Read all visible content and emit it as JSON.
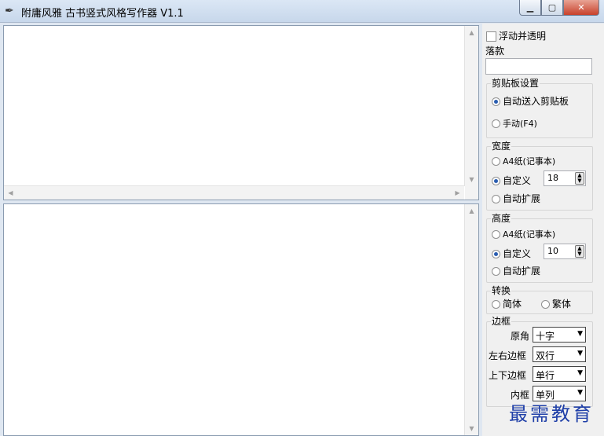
{
  "window": {
    "title": "附庸风雅 古书竖式风格写作器 V1.1",
    "app_icon": "pen-nib-icon",
    "min_glyph": "▁",
    "max_glyph": "▢",
    "close_glyph": "✕"
  },
  "editor": {
    "source_text": "",
    "output_text": ""
  },
  "options": {
    "float_transparent": "浮动并透明",
    "signature_label": "落款",
    "signature_value": "",
    "clipboard": {
      "title": "剪贴板设置",
      "auto": "自动送入剪贴板",
      "manual": "手动(F4)",
      "selected": "auto"
    },
    "width": {
      "title": "宽度",
      "a4": "A4纸(记事本)",
      "custom": "自定义",
      "custom_value": "18",
      "auto_expand": "自动扩展",
      "selected": "custom"
    },
    "height": {
      "title": "高度",
      "a4": "A4纸(记事本)",
      "custom": "自定义",
      "custom_value": "10",
      "auto_expand": "自动扩展",
      "selected": "custom"
    },
    "convert": {
      "title": "转换",
      "simplified": "简体",
      "traditional": "繁体"
    },
    "border": {
      "title": "边框",
      "corner_label": "原角",
      "corner_value": "十字",
      "lr_label": "左右边框",
      "lr_value": "双行",
      "tb_label": "上下边框",
      "tb_value": "单行",
      "inner_label": "内框",
      "inner_value": "单列"
    }
  },
  "watermark": "最需教育",
  "colors": {
    "radio_dot": "#2a5db0",
    "watermark": "#1f3fa8",
    "close_button": "#c8412b"
  }
}
